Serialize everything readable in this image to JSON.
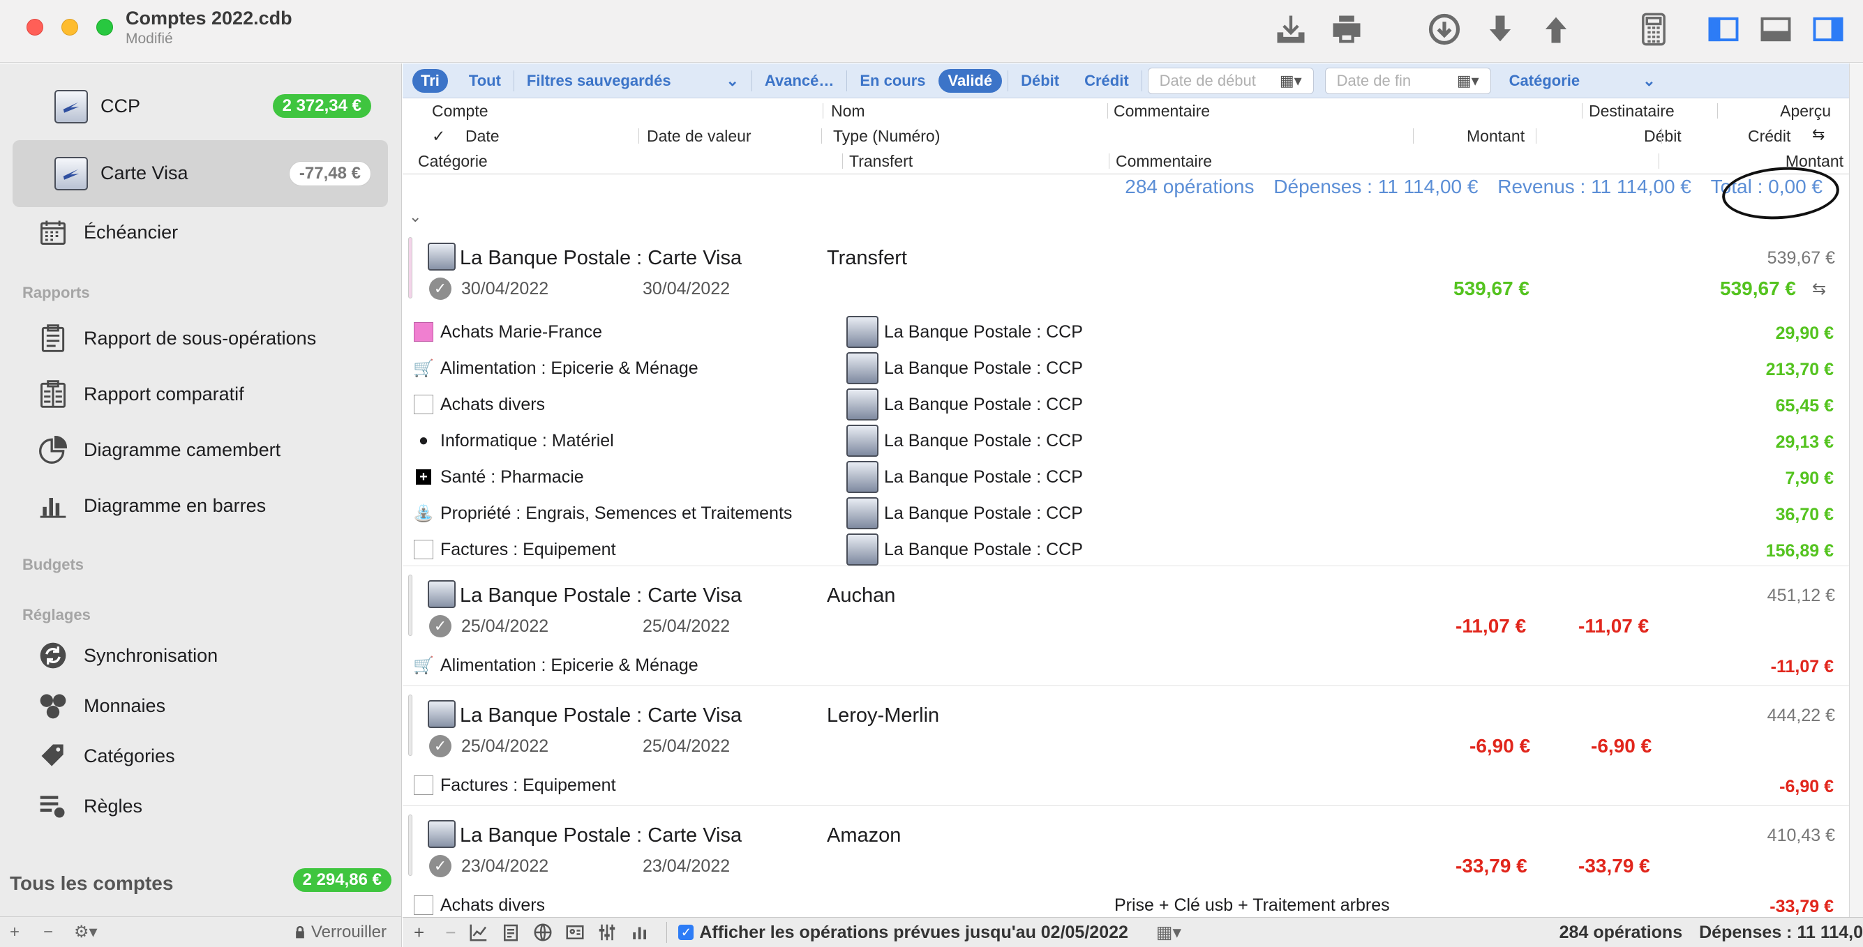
{
  "window": {
    "title": "Comptes 2022.cdb",
    "subtitle": "Modifié"
  },
  "toolbar": {
    "icons": [
      "download-tray-icon",
      "print-icon",
      "circle-down-icon",
      "arrow-down-icon",
      "arrow-up-icon",
      "calculator-icon",
      "sidebar-left-icon",
      "panel-bottom-icon",
      "sidebar-right-icon"
    ]
  },
  "sidebar": {
    "accounts": [
      {
        "name": "CCP",
        "balance": "2 372,34 €"
      },
      {
        "name": "Carte Visa",
        "balance": "-77,48 €"
      }
    ],
    "echeancier": "Échéancier",
    "reports_title": "Rapports",
    "reports": [
      "Rapport de sous-opérations",
      "Rapport comparatif",
      "Diagramme camembert",
      "Diagramme en barres"
    ],
    "budgets_title": "Budgets",
    "settings_title": "Réglages",
    "settings": [
      "Synchronisation",
      "Monnaies",
      "Catégories",
      "Règles"
    ],
    "all_accounts": "Tous les comptes",
    "all_balance": "2 294,86 €",
    "lock": "Verrouiller"
  },
  "filters": {
    "tri": "Tri",
    "tout": "Tout",
    "saved": "Filtres sauvegardés",
    "advanced": "Avancé…",
    "en_cours": "En cours",
    "valide": "Validé",
    "debit": "Débit",
    "credit": "Crédit",
    "date_start": "Date de début",
    "date_end": "Date de fin",
    "category": "Catégorie"
  },
  "columns": {
    "compte": "Compte",
    "nom": "Nom",
    "commentaire": "Commentaire",
    "destinataire": "Destinataire",
    "apercu": "Aperçu",
    "check": "✓",
    "date": "Date",
    "date_valeur": "Date de valeur",
    "type": "Type (Numéro)",
    "montant": "Montant",
    "debit": "Débit",
    "credit": "Crédit",
    "categorie": "Catégorie",
    "transfert": "Transfert",
    "commentaire2": "Commentaire",
    "montant2": "Montant"
  },
  "summary": {
    "operations": "284 opérations",
    "depenses": "Dépenses : 11 114,00 €",
    "revenus": "Revenus : 11 114,00 €",
    "total": "Total : 0,00 €"
  },
  "transactions": [
    {
      "account": "La Banque Postale : Carte Visa",
      "payee": "Transfert",
      "balance": "539,67 €",
      "date": "30/04/2022",
      "value_date": "30/04/2022",
      "amount": "539,67 €",
      "credit": "539,67 €",
      "splits": [
        {
          "icon": "pink-square",
          "category": "Achats Marie-France",
          "dest": "La Banque Postale : CCP",
          "amount": "29,90 €"
        },
        {
          "icon": "cart-icon",
          "category": "Alimentation : Epicerie & Ménage",
          "dest": "La Banque Postale : CCP",
          "amount": "213,70 €"
        },
        {
          "icon": "empty-box",
          "category": "Achats divers",
          "dest": "La Banque Postale : CCP",
          "amount": "65,45 €"
        },
        {
          "icon": "apple-icon",
          "category": "Informatique : Matériel",
          "dest": "La Banque Postale : CCP",
          "amount": "29,13 €"
        },
        {
          "icon": "plus-icon",
          "category": "Santé : Pharmacie",
          "dest": "La Banque Postale : CCP",
          "amount": "7,90 €"
        },
        {
          "icon": "watering-can-icon",
          "category": "Propriété : Engrais, Semences et Traitements",
          "dest": "La Banque Postale : CCP",
          "amount": "36,70 €"
        },
        {
          "icon": "empty-box",
          "category": "Factures : Equipement",
          "dest": "La Banque Postale : CCP",
          "amount": "156,89 €"
        }
      ]
    },
    {
      "account": "La Banque Postale : Carte Visa",
      "payee": "Auchan",
      "balance": "451,12 €",
      "date": "25/04/2022",
      "value_date": "25/04/2022",
      "amount": "-11,07 €",
      "debit": "-11,07 €",
      "splits": [
        {
          "icon": "cart-icon",
          "category": "Alimentation : Epicerie & Ménage",
          "amount": "-11,07 €"
        }
      ]
    },
    {
      "account": "La Banque Postale : Carte Visa",
      "payee": "Leroy-Merlin",
      "balance": "444,22 €",
      "date": "25/04/2022",
      "value_date": "25/04/2022",
      "amount": "-6,90 €",
      "debit": "-6,90 €",
      "splits": [
        {
          "icon": "empty-box",
          "category": "Factures : Equipement",
          "amount": "-6,90 €"
        }
      ]
    },
    {
      "account": "La Banque Postale : Carte Visa",
      "payee": "Amazon",
      "balance": "410,43 €",
      "date": "23/04/2022",
      "value_date": "23/04/2022",
      "amount": "-33,79 €",
      "debit": "-33,79 €",
      "splits": [
        {
          "icon": "empty-box",
          "category": "Achats divers",
          "comment": "Prise + Clé usb + Traitement arbres",
          "amount": "-33,79 €"
        }
      ]
    }
  ],
  "bottom": {
    "show_planned": "Afficher les opérations prévues jusqu'au 02/05/2022",
    "count": "284 opérations",
    "depenses": "Dépenses : 11 114,0"
  }
}
